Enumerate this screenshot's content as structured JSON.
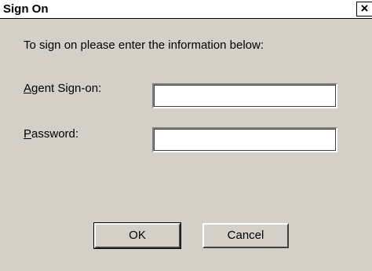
{
  "window": {
    "title": "Sign On",
    "close_glyph": "×"
  },
  "intro": "To sign on please enter the information below:",
  "fields": {
    "agent": {
      "mnemonic": "A",
      "label_rest": "gent Sign-on:",
      "value": ""
    },
    "password": {
      "mnemonic": "P",
      "label_rest": "assword:",
      "value": ""
    }
  },
  "buttons": {
    "ok": "OK",
    "cancel": "Cancel"
  }
}
